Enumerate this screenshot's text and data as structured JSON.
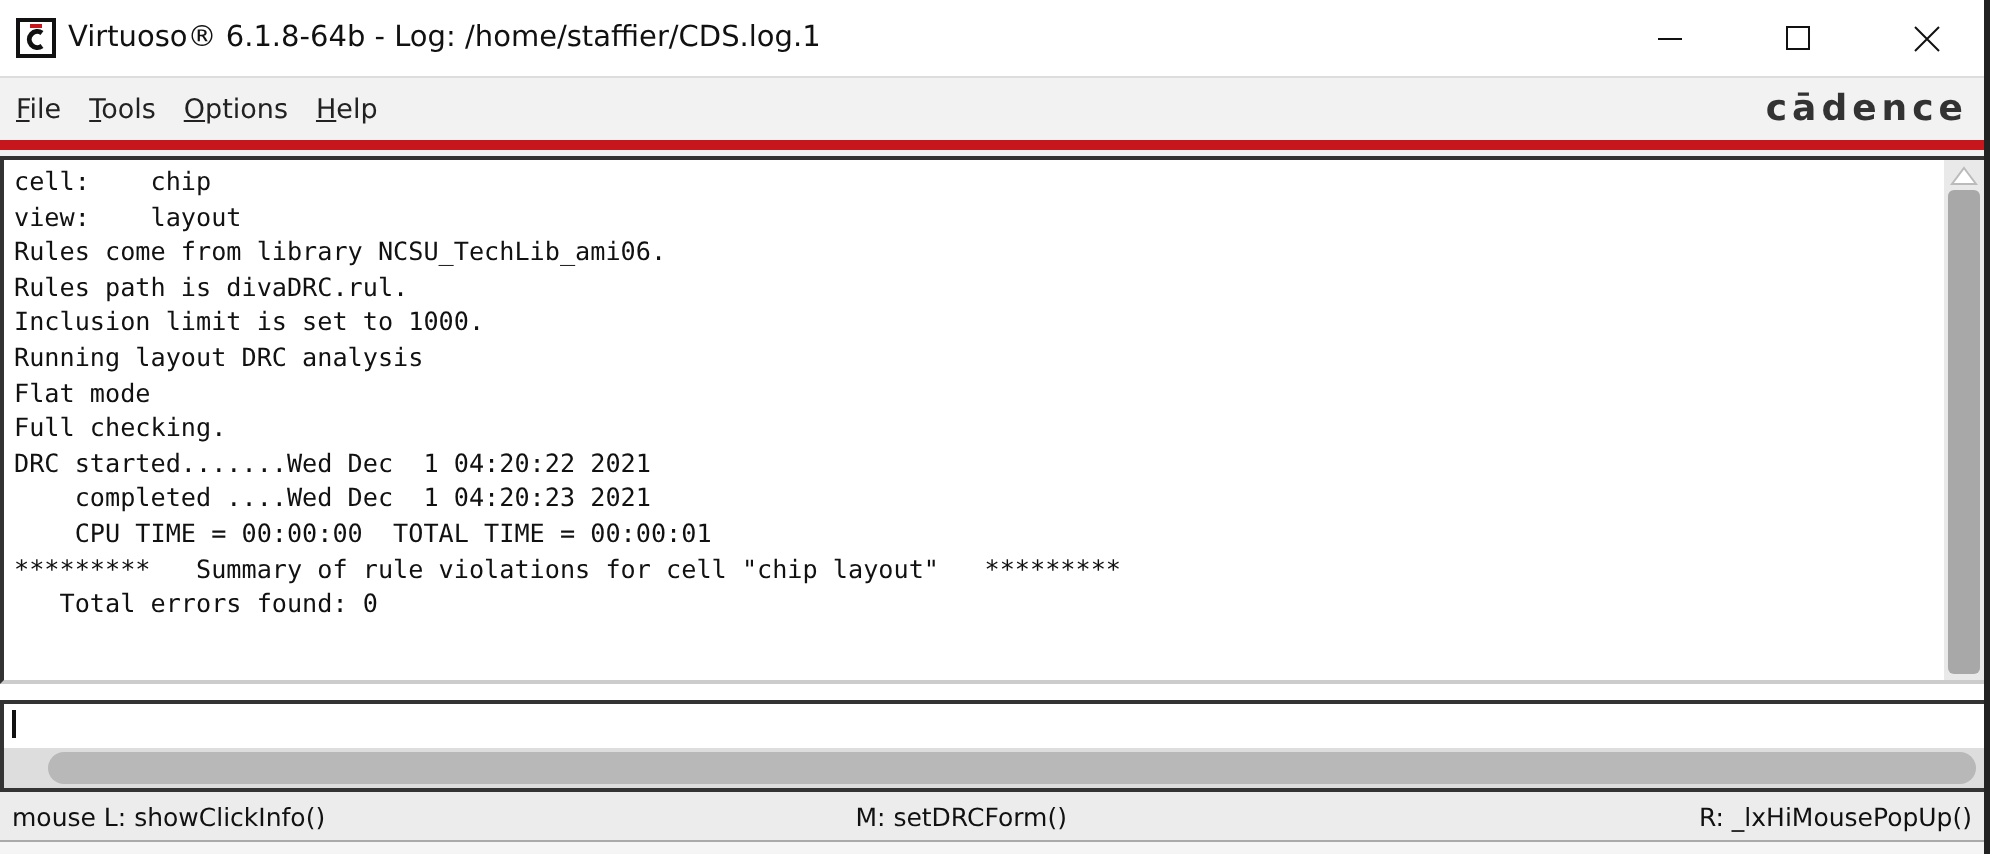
{
  "window": {
    "title": "Virtuoso® 6.1.8-64b - Log: /home/staffier/CDS.log.1"
  },
  "menu": [
    {
      "label": "File"
    },
    {
      "label": "Tools"
    },
    {
      "label": "Options"
    },
    {
      "label": "Help"
    }
  ],
  "brand": "cādence",
  "log": [
    "cell:    chip",
    "view:    layout",
    "Rules come from library NCSU_TechLib_ami06.",
    "Rules path is divaDRC.rul.",
    "Inclusion limit is set to 1000.",
    "Running layout DRC analysis",
    "Flat mode",
    "Full checking.",
    "DRC started.......Wed Dec  1 04:20:22 2021",
    "    completed ....Wed Dec  1 04:20:23 2021",
    "    CPU TIME = 00:00:00  TOTAL TIME = 00:00:01",
    "*********   Summary of rule violations for cell \"chip layout\"   *********",
    "   Total errors found: 0"
  ],
  "status_bar": {
    "left": "mouse L: showClickInfo()",
    "middle": "M: setDRCForm()",
    "right": "R: _lxHiMousePopUp()"
  }
}
